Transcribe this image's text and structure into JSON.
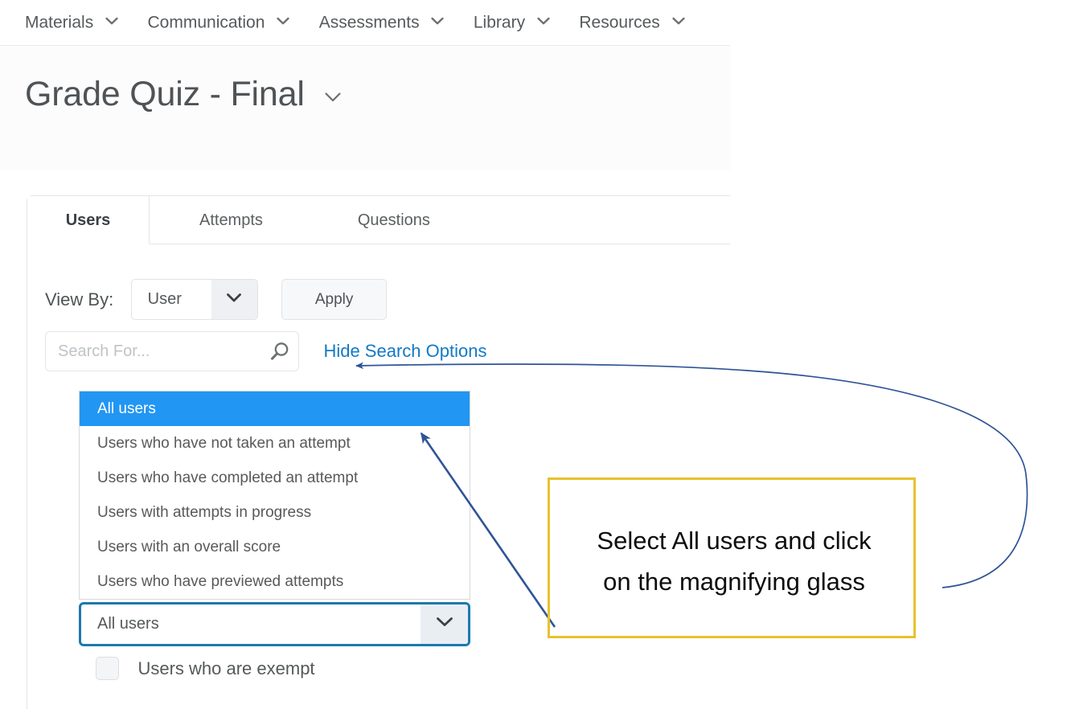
{
  "topnav": {
    "items": [
      {
        "label": "Materials",
        "icon": "chevron-down-icon"
      },
      {
        "label": "Communication",
        "icon": "chevron-down-icon"
      },
      {
        "label": "Assessments",
        "icon": "chevron-down-icon"
      },
      {
        "label": "Library",
        "icon": "chevron-down-icon"
      },
      {
        "label": "Resources",
        "icon": "chevron-down-icon"
      }
    ]
  },
  "header": {
    "title": "Grade Quiz - Final",
    "title_menu_icon": "chevron-down-icon"
  },
  "tabs": [
    {
      "label": "Users",
      "active": true
    },
    {
      "label": "Attempts",
      "active": false
    },
    {
      "label": "Questions",
      "active": false
    }
  ],
  "toolbar": {
    "view_by_label": "View By:",
    "view_by_value": "User",
    "view_by_arrow_icon": "chevron-down-icon",
    "apply_label": "Apply"
  },
  "search": {
    "placeholder": "Search For...",
    "value": "",
    "icon": "search-icon",
    "hide_options_label": "Hide Search Options"
  },
  "options_list": {
    "items": [
      {
        "label": "All users",
        "selected": true
      },
      {
        "label": "Users who have not taken an attempt",
        "selected": false
      },
      {
        "label": "Users who have completed an attempt",
        "selected": false
      },
      {
        "label": "Users with attempts in progress",
        "selected": false
      },
      {
        "label": "Users with an overall score",
        "selected": false
      },
      {
        "label": "Users who have previewed attempts",
        "selected": false
      }
    ]
  },
  "user_filter_select": {
    "value": "All users",
    "arrow_icon": "chevron-down-icon"
  },
  "exempt_filter": {
    "label": "Users who are exempt",
    "checked": false
  },
  "annotation": {
    "text_line_1": "Select All users and click",
    "text_line_2": "on the magnifying glass",
    "box_color": "#e8c22c",
    "arrow_color": "#2f5496"
  },
  "colors": {
    "selection_blue": "#2196f3",
    "link_blue": "#1279c6",
    "focus_border": "#1c79ae",
    "callout_gold": "#e8c22c"
  }
}
